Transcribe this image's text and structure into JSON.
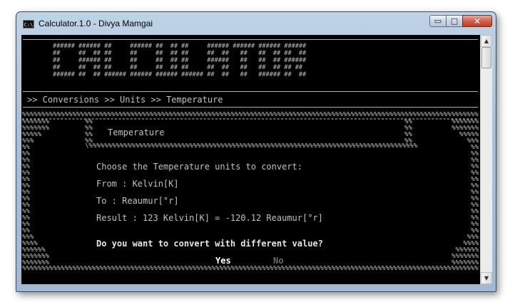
{
  "window": {
    "title": "Calculator.1.0 - Divya Mamgai",
    "app_icon_text": "C:\\",
    "minimize_glyph": "▭",
    "maximize_glyph": "□",
    "close_glyph": "✕"
  },
  "console": {
    "banner_art": "###### ###### ##     ###### ##  ## ##     ###### ###### ###### ######\n##     ##  ## ##     ##     ##  ## ##     ##  ##   ##   ##  ## ##  ##\n##     ###### ##     ##     ##  ## ##     ######   ##   ##  ## ######\n##     ##  ## ##     ##     ##  ## ##     ##  ##   ##   ##  ## ## ##\n###### ##  ## ###### ###### ###### ###### ##  ##   ##   ###### ##  ##",
    "breadcrumb": ">> Conversions >> Units >> Temperature",
    "box_title": "Temperature",
    "prompt": "Choose the Temperature units to convert:",
    "from_line": "From : Kelvin[K]",
    "to_line": "To : Reaumur[°r]",
    "result_line": "Result : 123 Kelvin[K] = -120.12 Reaumur[°r]",
    "question": "Do you want to convert with different value?",
    "yes_label": "Yes",
    "no_label": "No"
  },
  "scrollbar": {
    "up_glyph": "▲",
    "down_glyph": "▼"
  },
  "colors": {
    "console_bg": "#000000",
    "console_text": "#c0c0c0",
    "selected_option": "#ffffff",
    "unselected_option": "#6a6a6a"
  }
}
